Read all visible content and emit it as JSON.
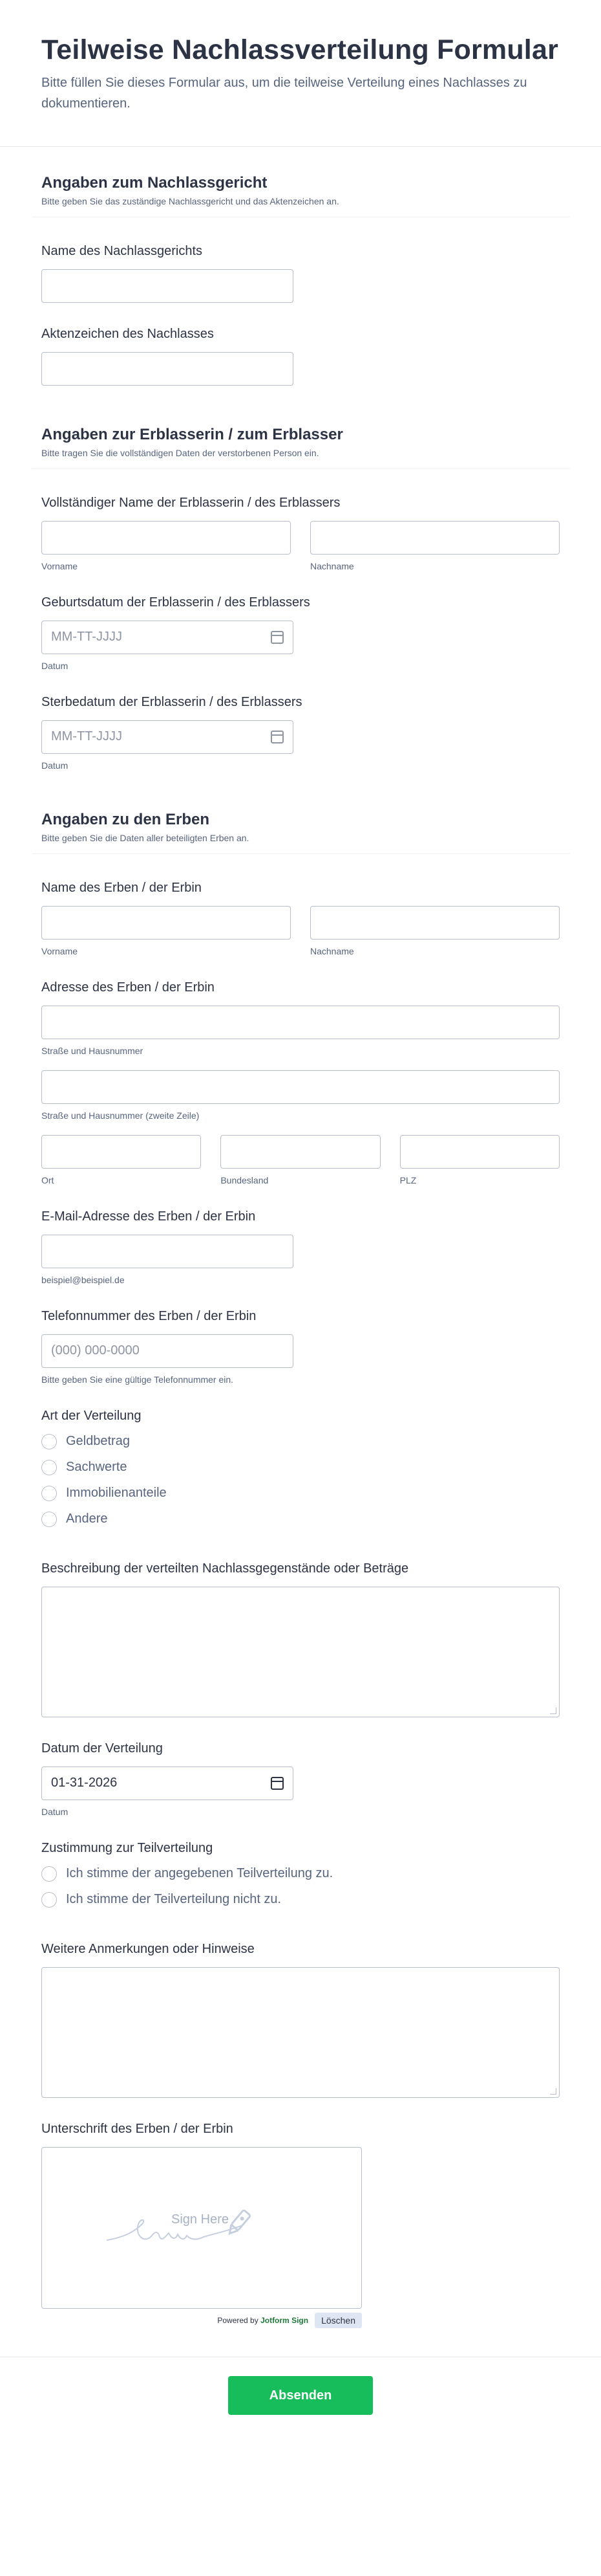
{
  "header": {
    "title": "Teilweise Nachlassverteilung Formular",
    "subtitle": "Bitte füllen Sie dieses Formular aus, um die teilweise Verteilung eines Nachlasses zu dokumentieren."
  },
  "court": {
    "title": "Angaben zum Nachlassgericht",
    "desc": "Bitte geben Sie das zuständige Nachlassgericht und das Aktenzeichen an.",
    "name_label": "Name des Nachlassgerichts",
    "file_label": "Aktenzeichen des Nachlasses"
  },
  "deceased": {
    "title": "Angaben zur Erblasserin / zum Erblasser",
    "desc": "Bitte tragen Sie die vollständigen Daten der verstorbenen Person ein.",
    "fullname_label": "Vollständiger Name der Erblasserin / des Erblassers",
    "first_sub": "Vorname",
    "last_sub": "Nachname",
    "birth_label": "Geburtsdatum der Erblasserin / des Erblassers",
    "birth_placeholder": "MM-TT-JJJJ",
    "birth_sub": "Datum",
    "death_label": "Sterbedatum der Erblasserin / des Erblassers",
    "death_placeholder": "MM-TT-JJJJ",
    "death_sub": "Datum"
  },
  "heirs": {
    "title": "Angaben zu den Erben",
    "desc": "Bitte geben Sie die Daten aller beteiligten Erben an.",
    "name_label": "Name des Erben / der Erbin",
    "first_sub": "Vorname",
    "last_sub": "Nachname",
    "address_label": "Adresse des Erben / der Erbin",
    "street_sub": "Straße und Hausnummer",
    "street2_sub": "Straße und Hausnummer (zweite Zeile)",
    "city_sub": "Ort",
    "state_sub": "Bundesland",
    "zip_sub": "PLZ",
    "email_label": "E-Mail-Adresse des Erben / der Erbin",
    "email_sub": "beispiel@beispiel.de",
    "phone_label": "Telefonnummer des Erben / der Erbin",
    "phone_placeholder": "(000) 000-0000",
    "phone_sub": "Bitte geben Sie eine gültige Telefonnummer ein.",
    "type_label": "Art der Verteilung",
    "type_options": [
      "Geldbetrag",
      "Sachwerte",
      "Immobilienanteile",
      "Andere"
    ],
    "desc_label": "Beschreibung der verteilten Nachlassgegenstände oder Beträge",
    "date_label": "Datum der Verteilung",
    "date_value": "01-31-2026",
    "date_sub": "Datum",
    "consent_label": "Zustimmung zur Teilverteilung",
    "consent_options": [
      "Ich stimme der angegebenen Teilverteilung zu.",
      "Ich stimme der Teilverteilung nicht zu."
    ],
    "notes_label": "Weitere Anmerkungen oder Hinweise",
    "signature_label": "Unterschrift des Erben / der Erbin",
    "sign_here": "Sign Here",
    "powered_prefix": "Powered by",
    "powered_brand": "Jotform Sign",
    "clear_label": "Löschen"
  },
  "footer": {
    "submit_label": "Absenden"
  },
  "colors": {
    "accent_submit": "#18bd5b",
    "text": "#2c3345",
    "muted": "#57647e",
    "border": "#b8bdc9"
  }
}
